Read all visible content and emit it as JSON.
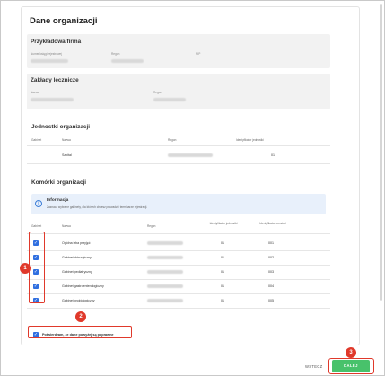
{
  "title": "Dane organizacji",
  "firm": {
    "heading": "Przykładowa firma",
    "labels": [
      "Numer księgi rejestrowej",
      "Regon",
      "NIP"
    ]
  },
  "facilities": {
    "heading": "Zakłady lecznicze",
    "labels": [
      "Nazwa",
      "Regon"
    ]
  },
  "units": {
    "heading": "Jednostki organizacji",
    "columns": [
      "Gabinet",
      "Nazwa",
      "Regon",
      "Identyfikator jednostki"
    ],
    "rows": [
      {
        "name": "Szpital",
        "id": "01"
      }
    ]
  },
  "cells": {
    "heading": "Komórki organizacji",
    "info_title": "Informacja",
    "info_text": "Zaznacz wybrane gabinety, dla których chcesz prowadzić terminarze rejestracji.",
    "columns": [
      "Gabinet",
      "Nazwa",
      "Regon",
      "Identyfikator jednostki",
      "Identyfikator komórki"
    ],
    "rows": [
      {
        "name": "Ogólna izba przyjęć",
        "unit": "01",
        "cell": "001",
        "checked": true
      },
      {
        "name": "Gabinet chirurgiczny",
        "unit": "01",
        "cell": "002",
        "checked": true
      },
      {
        "name": "Gabinet pediatryczny",
        "unit": "01",
        "cell": "003",
        "checked": true
      },
      {
        "name": "Gabinet gastroenterologiczny",
        "unit": "01",
        "cell": "004",
        "checked": true
      },
      {
        "name": "Gabinet proktologiczny",
        "unit": "01",
        "cell": "005",
        "checked": true
      }
    ]
  },
  "confirm_label": "Potwierdzam, że dane powyżej są poprawne",
  "confirm_checked": true,
  "badges": [
    "1",
    "2",
    "3"
  ],
  "footer": {
    "back_label": "WSTECZ",
    "next_label": "DALEJ"
  },
  "colors": {
    "accent": "#2f6fe0",
    "highlight": "#e0392b",
    "next": "#48c26b"
  }
}
